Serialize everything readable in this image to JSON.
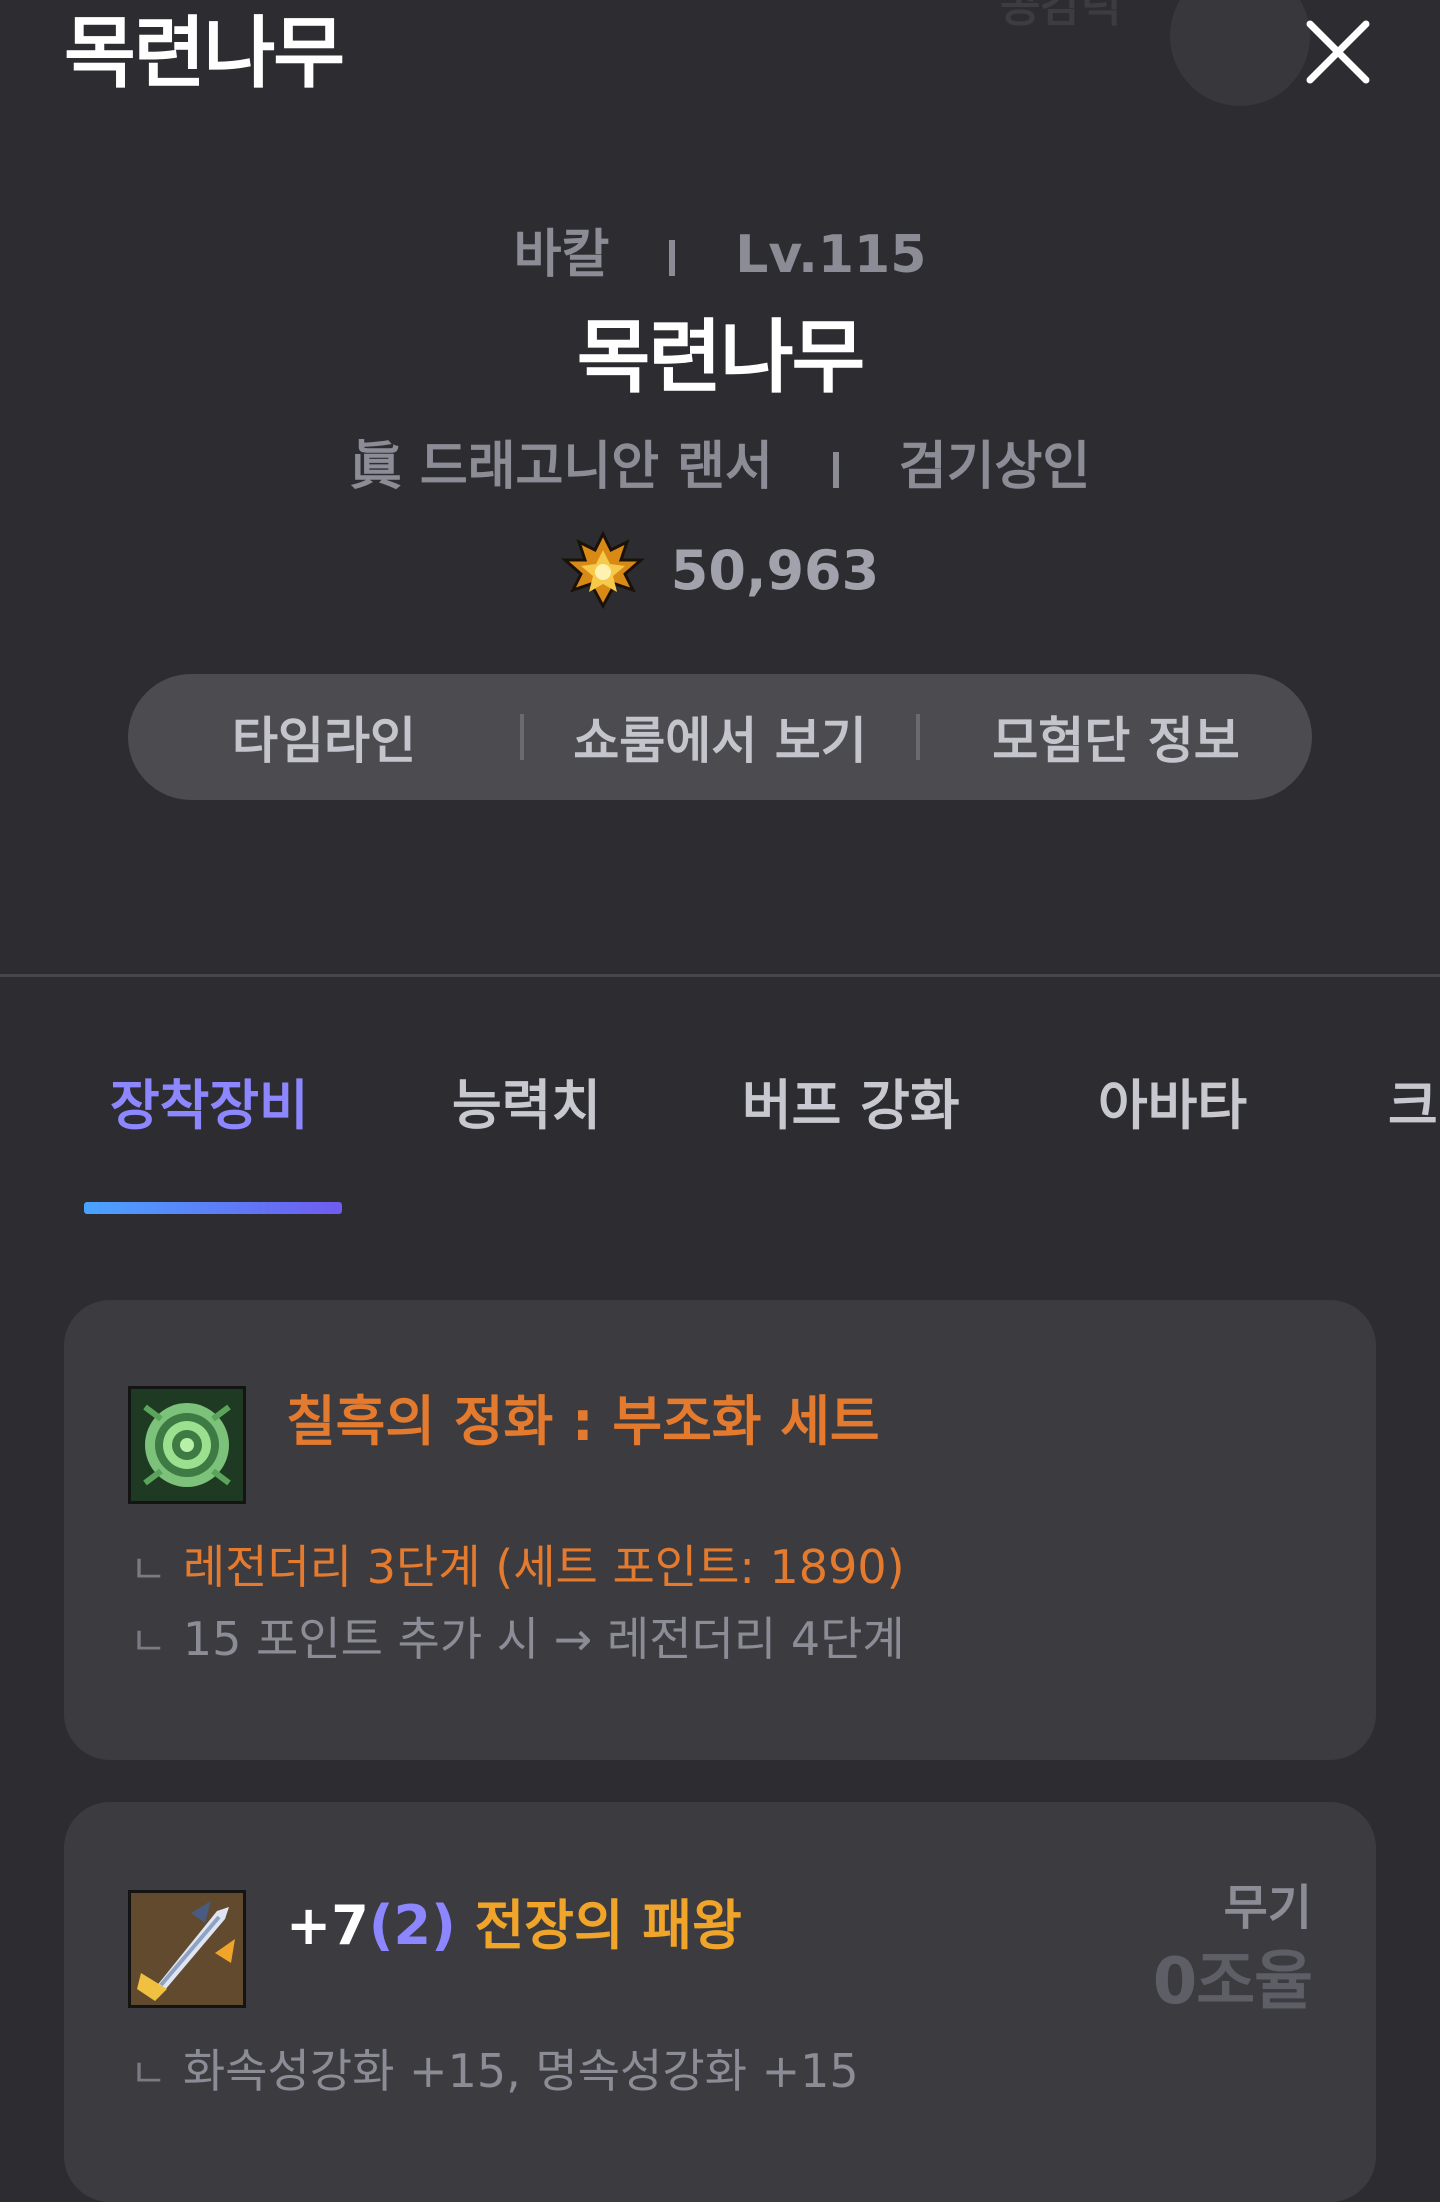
{
  "header": {
    "title": "목련나무",
    "ghost_text": "공감덕"
  },
  "profile": {
    "server": "바칼",
    "level": "Lv.115",
    "name": "목련나무",
    "class": "眞 드래고니안 랜서",
    "title": "검기상인",
    "fame": "50,963"
  },
  "actions": [
    "타임라인",
    "쇼룸에서 보기",
    "모험단 정보"
  ],
  "tabs": [
    "장착장비",
    "능력치",
    "버프 강화",
    "아바타",
    "크"
  ],
  "set_card": {
    "name": "칠흑의 정화 : 부조화 세트",
    "grade_line": "레전더리 3단계 (세트 포인트: 1890)",
    "next_line": "15 포인트 추가 시 → 레전더리 4단계",
    "mark": "ㄴ"
  },
  "weapon_card": {
    "plus": "+7",
    "amp": "(2)",
    "name": "전장의 패왕",
    "slot": "무기",
    "tune": "0조율",
    "enchant_line": "화속성강화 +15, 명속성강화 +15",
    "mark": "ㄴ"
  },
  "colors": {
    "background": "#2d2d31",
    "card": "#3b3b40",
    "accent": "#8c86ff",
    "set_orange": "#e47a2e",
    "item_gold": "#f0a52a"
  }
}
